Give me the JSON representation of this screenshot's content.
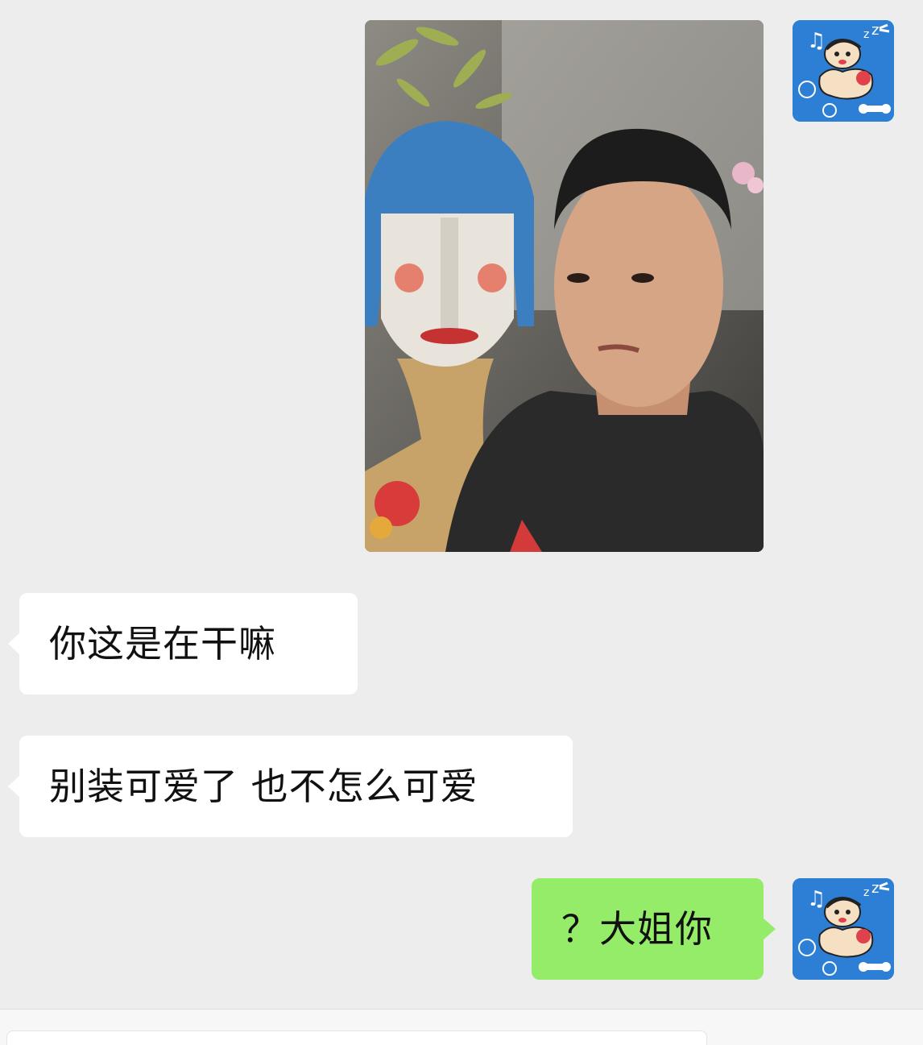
{
  "messages": [
    {
      "direction": "outgoing",
      "type": "image",
      "content": "photo"
    },
    {
      "direction": "incoming",
      "type": "text",
      "text": "你这是在干嘛"
    },
    {
      "direction": "incoming",
      "type": "text",
      "text": "别装可爱了 也不怎么可爱"
    },
    {
      "direction": "outgoing",
      "type": "text",
      "text": "？大姐你"
    }
  ],
  "colors": {
    "background": "#ededed",
    "incoming_bubble": "#ffffff",
    "outgoing_bubble": "#95ec69",
    "avatar_bg": "#2d7fd6"
  },
  "icons": {
    "self_avatar": "crayon-shinchan-avatar-icon"
  }
}
